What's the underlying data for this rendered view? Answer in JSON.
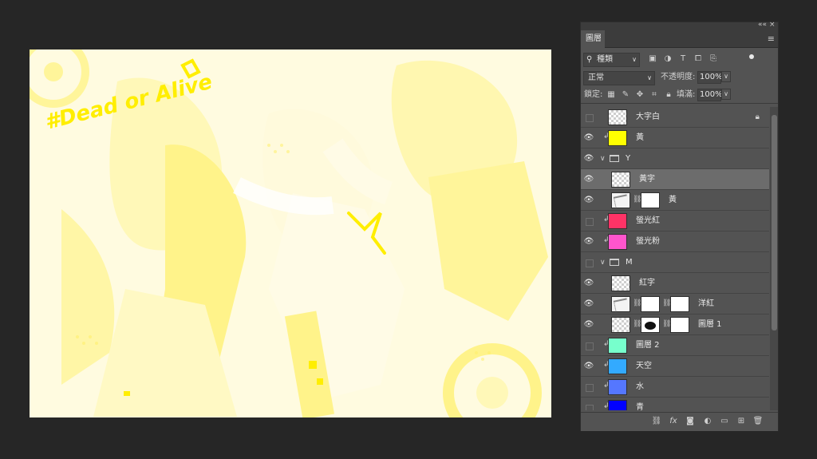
{
  "panel": {
    "tab_label": "圖層",
    "kind_filter": "種類",
    "blend_mode": "正常",
    "opacity_label": "不透明度:",
    "opacity_value": "100%",
    "lock_label": "鎖定:",
    "fill_label": "填滿:",
    "fill_value": "100%",
    "collapse_glyph": "««",
    "close_glyph": "×",
    "menu_glyph": "≡"
  },
  "canvas_art": {
    "text": "#Dead or Alive",
    "colors": {
      "yellow": "#ffff00",
      "pale_yellow": "#fff79a",
      "background": "#fffde8"
    }
  },
  "layers": [
    {
      "name": "大字白",
      "visible": false,
      "clipped": false,
      "thumb": "checker",
      "locked": true,
      "indent": 0
    },
    {
      "name": "黃",
      "visible": true,
      "clipped": true,
      "thumb": "color",
      "color": "#ffff00",
      "indent": 0
    },
    {
      "name": "Y",
      "visible": true,
      "group": true,
      "indent": 0
    },
    {
      "name": "黃字",
      "visible": true,
      "clipped": false,
      "thumb": "checker",
      "selected": true,
      "indent": 1
    },
    {
      "name": "黃",
      "visible": true,
      "clipped": false,
      "thumb": "art",
      "mask": "white-text",
      "indent": 1
    },
    {
      "name": "螢光紅",
      "visible": false,
      "clipped": true,
      "thumb": "color",
      "color": "#ff3366",
      "indent": 0
    },
    {
      "name": "螢光粉",
      "visible": true,
      "clipped": true,
      "thumb": "color",
      "color": "#ff55cc",
      "indent": 0
    },
    {
      "name": "M",
      "visible": false,
      "group": true,
      "indent": 0
    },
    {
      "name": "紅字",
      "visible": true,
      "clipped": false,
      "thumb": "checker",
      "indent": 1
    },
    {
      "name": "洋紅",
      "visible": true,
      "clipped": false,
      "thumb": "art",
      "mask": "white-text",
      "mask2": true,
      "indent": 1
    },
    {
      "name": "圖層 1",
      "visible": true,
      "clipped": false,
      "thumb": "checker",
      "mask": "dark-blob",
      "mask2": true,
      "indent": 1
    },
    {
      "name": "圖層 2",
      "visible": false,
      "clipped": true,
      "thumb": "color",
      "color": "#77ffcc",
      "indent": 0
    },
    {
      "name": "天空",
      "visible": true,
      "clipped": true,
      "thumb": "color",
      "color": "#33aaff",
      "indent": 0
    },
    {
      "name": "水",
      "visible": false,
      "clipped": true,
      "thumb": "color",
      "color": "#5577ff",
      "indent": 0
    },
    {
      "name": "青",
      "visible": false,
      "clipped": true,
      "thumb": "color",
      "color": "#0000ff",
      "indent": 0
    }
  ],
  "bottom_icons": [
    "link-icon",
    "fx-icon",
    "mask-icon",
    "adjustment-icon",
    "new-group-icon",
    "new-layer-icon",
    "trash-icon"
  ]
}
